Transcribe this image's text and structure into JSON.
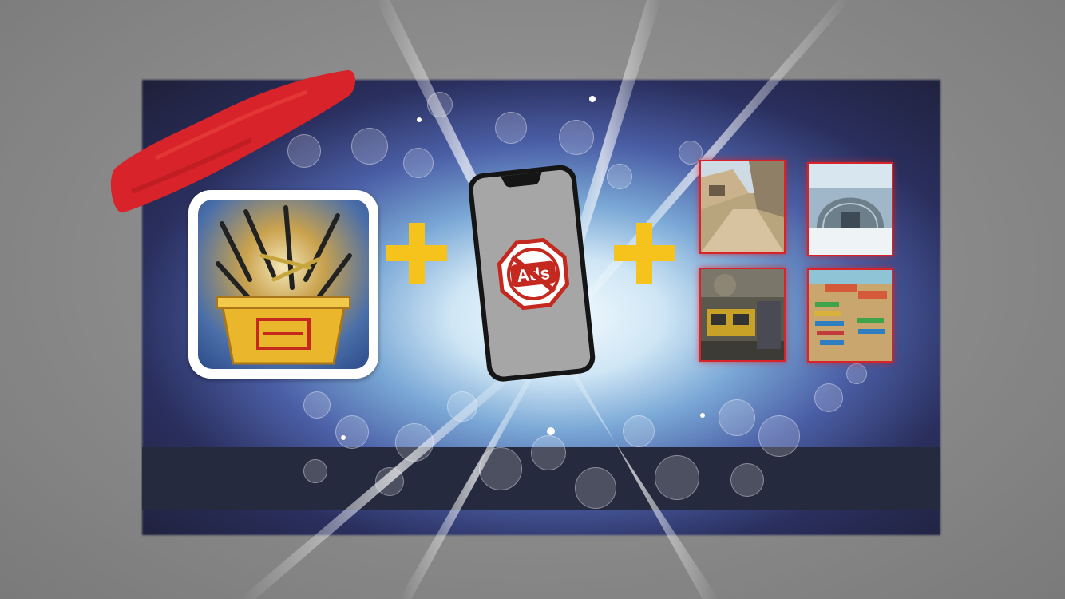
{
  "scene": {
    "colors": {
      "accent_yellow": "#f6c21c",
      "accent_red": "#d8232a",
      "base_bar": "#262a3f"
    },
    "bundle": {
      "items": [
        {
          "name": "case-app-icon",
          "icon": "weapon-case-icon"
        },
        {
          "name": "plus-icon",
          "icon": "plus-icon"
        },
        {
          "name": "no-ads-phone",
          "icon": "no-ads-icon",
          "sign_text": "Ads"
        },
        {
          "name": "plus-icon",
          "icon": "plus-icon"
        },
        {
          "name": "maps-grid",
          "icon": "map-thumbnails"
        }
      ]
    },
    "maps": [
      {
        "id": "map-1"
      },
      {
        "id": "map-2"
      },
      {
        "id": "map-3"
      },
      {
        "id": "map-4"
      }
    ]
  }
}
